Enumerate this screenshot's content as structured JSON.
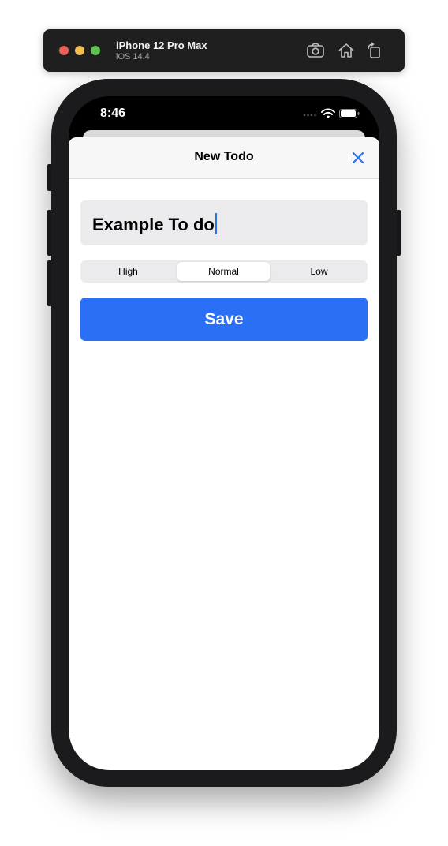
{
  "simulator": {
    "device_name": "iPhone 12 Pro Max",
    "os_version": "iOS 14.4",
    "toolbar_icons": [
      "screenshot-icon",
      "home-icon",
      "rotate-icon"
    ]
  },
  "status_bar": {
    "time": "8:46",
    "icons": [
      "wifi-icon",
      "battery-icon"
    ]
  },
  "nav": {
    "title": "New Todo",
    "close_icon": "close-icon"
  },
  "form": {
    "todo_text": "Example To do",
    "priority": {
      "options": [
        "High",
        "Normal",
        "Low"
      ],
      "selected": "Normal"
    },
    "save_label": "Save"
  },
  "colors": {
    "accent": "#2a70f6",
    "sheet_background": "#ffffff",
    "field_background": "#ebebed"
  }
}
